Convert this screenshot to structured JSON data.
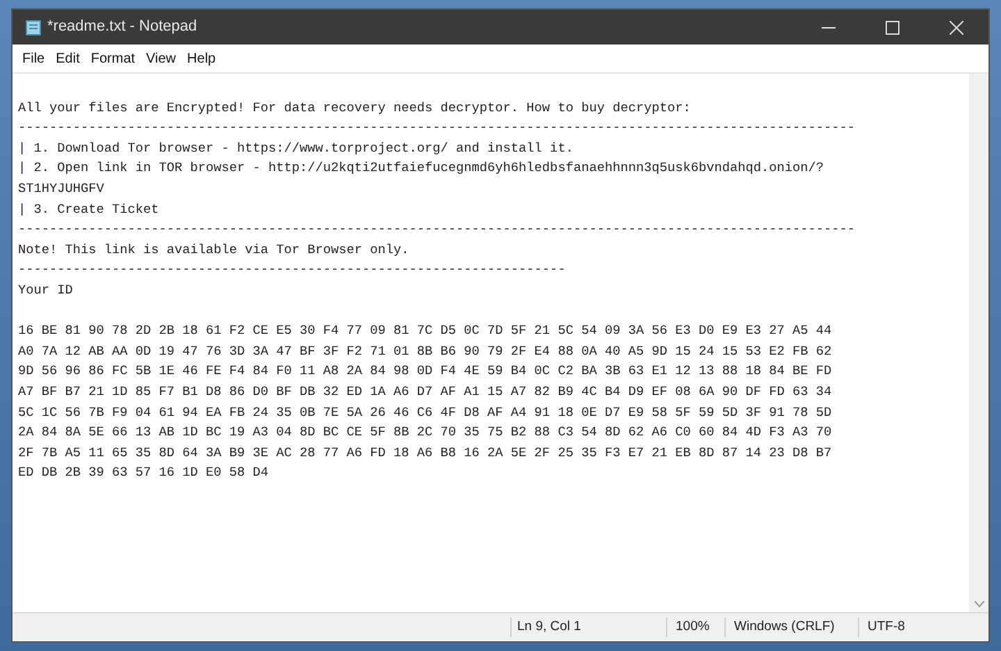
{
  "window": {
    "title": "*readme.txt - Notepad"
  },
  "menu": [
    "File",
    "Edit",
    "Format",
    "View",
    "Help"
  ],
  "lines": [
    {
      "kind": "blank"
    },
    {
      "kind": "text",
      "text": "All your files are Encrypted! For data recovery needs decryptor. How to buy decryptor:"
    },
    {
      "kind": "text",
      "text": "-----------------------------------------------------------------------------------------------------------"
    },
    {
      "kind": "text",
      "text": "| 1. Download Tor browser - https://www.torproject.org/ and install it."
    },
    {
      "kind": "text",
      "text": "| 2. Open link in TOR browser - http://u2kqti2utfaiefucegnmd6yh6hledbsfanaehhnnn3q5usk6bvndahqd.onion/?"
    },
    {
      "kind": "text",
      "text": "ST1HYJUHGFV"
    },
    {
      "kind": "text",
      "text": "| 3. Create Ticket"
    },
    {
      "kind": "text",
      "text": "-----------------------------------------------------------------------------------------------------------"
    },
    {
      "kind": "text",
      "text": "Note! This link is available via Tor Browser only."
    },
    {
      "kind": "text",
      "text": "----------------------------------------------------------------------"
    },
    {
      "kind": "text",
      "text": "Your ID"
    },
    {
      "kind": "blank"
    },
    {
      "kind": "text",
      "text": "16 BE 81 90 78 2D 2B 18 61 F2 CE E5 30 F4 77 09 81 7C D5 0C 7D 5F 21 5C 54 09 3A 56 E3 D0 E9 E3 27 A5 44"
    },
    {
      "kind": "text",
      "text": "A0 7A 12 AB AA 0D 19 47 76 3D 3A 47 BF 3F F2 71 01 8B B6 90 79 2F E4 88 0A 40 A5 9D 15 24 15 53 E2 FB 62"
    },
    {
      "kind": "text",
      "text": "9D 56 96 86 FC 5B 1E 46 FE F4 84 F0 11 A8 2A 84 98 0D F4 4E 59 B4 0C C2 BA 3B 63 E1 12 13 88 18 84 BE FD"
    },
    {
      "kind": "text",
      "text": "A7 BF B7 21 1D 85 F7 B1 D8 86 D0 BF DB 32 ED 1A A6 D7 AF A1 15 A7 82 B9 4C B4 D9 EF 08 6A 90 DF FD 63 34"
    },
    {
      "kind": "text",
      "text": "5C 1C 56 7B F9 04 61 94 EA FB 24 35 0B 7E 5A 26 46 C6 4F D8 AF A4 91 18 0E D7 E9 58 5F 59 5D 3F 91 78 5D"
    },
    {
      "kind": "text",
      "text": "2A 84 8A 5E 66 13 AB 1D BC 19 A3 04 8D BC CE 5F 8B 2C 70 35 75 B2 88 C3 54 8D 62 A6 C0 60 84 4D F3 A3 70"
    },
    {
      "kind": "text",
      "text": "2F 7B A5 11 65 35 8D 64 3A B9 3E AC 28 77 A6 FD 18 A6 B8 16 2A 5E 2F 25 35 F3 E7 21 EB 8D 87 14 23 D8 B7"
    },
    {
      "kind": "text",
      "text": "ED DB 2B 39 63 57 16 1D E0 58 D4"
    }
  ],
  "status_bar": {
    "position": "Ln 9, Col 1",
    "zoom": "100%",
    "line_endings": "Windows (CRLF)",
    "encoding": "UTF-8"
  }
}
